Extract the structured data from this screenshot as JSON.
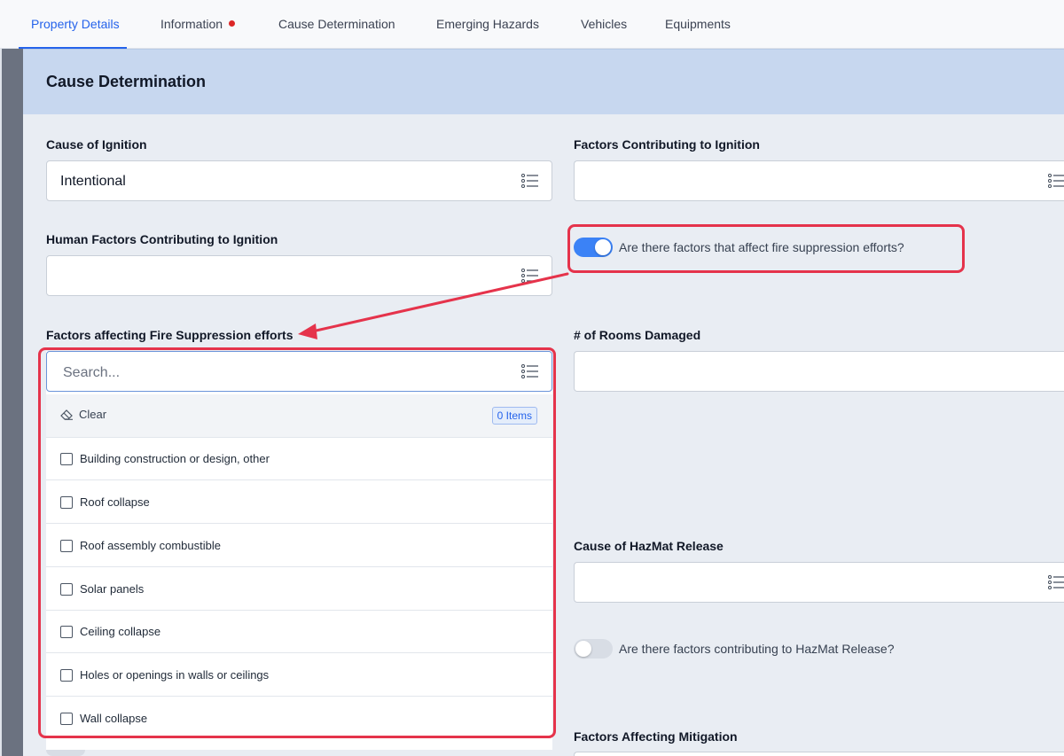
{
  "tabs": [
    {
      "label": "Property Details",
      "active": true
    },
    {
      "label": "Information",
      "active": false,
      "alert": true
    },
    {
      "label": "Cause Determination",
      "active": false
    },
    {
      "label": "Emerging Hazards",
      "active": false
    },
    {
      "label": "Vehicles",
      "active": false
    },
    {
      "label": "Equipments",
      "active": false
    }
  ],
  "section": {
    "title": "Cause Determination"
  },
  "fields": {
    "cause_of_ignition": {
      "label": "Cause of Ignition",
      "value": "Intentional"
    },
    "factors_contributing": {
      "label": "Factors Contributing to Ignition",
      "value": ""
    },
    "human_factors": {
      "label": "Human Factors Contributing to Ignition",
      "value": ""
    },
    "suppression_factors": {
      "label": "Factors affecting Fire Suppression efforts"
    },
    "rooms_damaged": {
      "label": "# of Rooms Damaged",
      "value": ""
    },
    "hazmat_cause": {
      "label": "Cause of HazMat Release",
      "value": ""
    },
    "mitigation": {
      "label": "Factors Affecting Mitigation"
    }
  },
  "toggles": {
    "suppression": {
      "label": "Are there factors that affect fire suppression efforts?",
      "on": true
    },
    "hazmat": {
      "label": "Are there factors contributing to HazMat Release?",
      "on": false
    }
  },
  "dropdown": {
    "search_placeholder": "Search...",
    "clear_label": "Clear",
    "items_badge": "0 Items",
    "options": [
      "Building construction or design, other",
      "Roof collapse",
      "Roof assembly combustible",
      "Solar panels",
      "Ceiling collapse",
      "Holes or openings in walls or ceilings",
      "Wall collapse"
    ]
  },
  "colors": {
    "accent": "#2563eb",
    "highlight": "#e5334b",
    "header": "#c7d7ef",
    "panel": "#e9edf3"
  },
  "icons": {
    "field_menu": "list-icon",
    "clear": "eraser-icon",
    "alert": "red-dot-icon"
  }
}
